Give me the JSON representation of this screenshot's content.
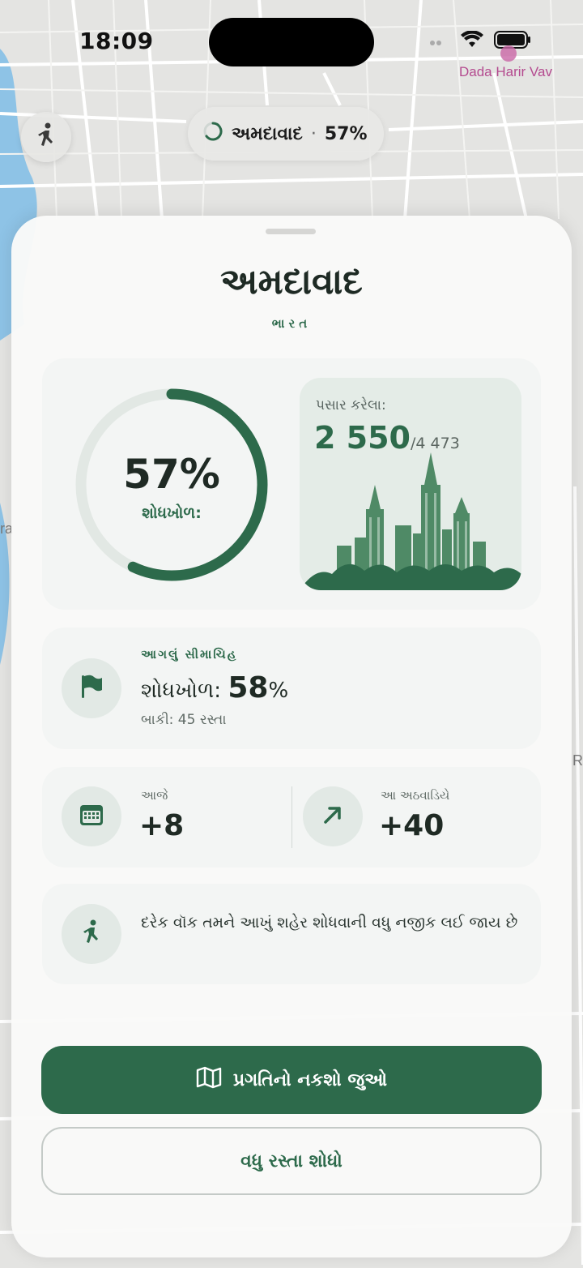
{
  "status_bar": {
    "time": "18:09"
  },
  "map": {
    "poi_label": "Dada Harir Vav",
    "edge_left": "ra",
    "edge_right": "R"
  },
  "top_pill": {
    "city": "અમદાવાદ",
    "separator": "·",
    "percent": "57%"
  },
  "sheet": {
    "title": "અમદાવાદ",
    "subtitle": "ભારત",
    "progress": {
      "percent_text": "57%",
      "percent_value": 0.57,
      "label": "શોધખોળ:",
      "passed_label": "પસાર કરેલા:",
      "passed_value": "2 550",
      "passed_total": "/4 473"
    },
    "milestone": {
      "heading": "આગલું સીમાચિહ",
      "main_label": "શોધખોળ:",
      "main_value": "58",
      "main_unit": "%",
      "remaining": "બાકી: 45 રસ્તા",
      "icon": "flag-icon"
    },
    "stats": {
      "today_label": "આજે",
      "today_value": "+8",
      "today_icon": "calendar-icon",
      "week_label": "આ અઠવાડિયે",
      "week_value": "+40",
      "week_icon": "trend-up-arrow-icon"
    },
    "tip": {
      "text": "દરેક વૉક તમને આખું શહેર શોધવાની વધુ નજીક લઈ જાય છે",
      "icon": "walking-person-icon"
    },
    "primary_button": {
      "label": "પ્રગતિનો નકશો જુઓ",
      "icon": "map-icon"
    },
    "secondary_button": {
      "label": "વધુ રસ્તા શોધો"
    }
  },
  "colors": {
    "accent": "#2d6a4b",
    "ring_track": "#e2e8e4",
    "card": "#f3f5f4"
  }
}
